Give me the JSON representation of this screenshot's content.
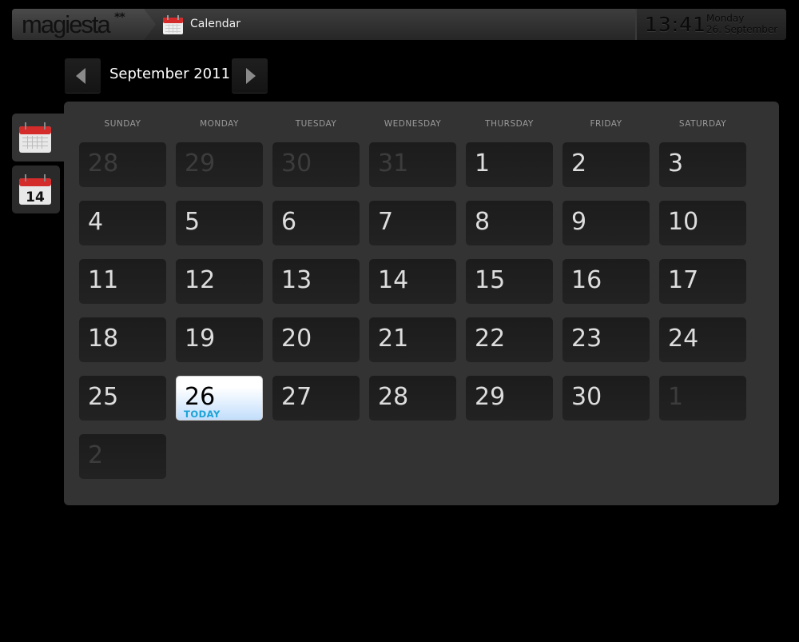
{
  "header": {
    "logo": "magiesta",
    "logo_mark": "**",
    "app_icon": "calendar-icon",
    "app_title": "Calendar",
    "clock_time": "13:41",
    "clock_weekday": "Monday",
    "clock_date": "26. September"
  },
  "nav": {
    "prev_icon": "triangle-left-icon",
    "next_icon": "triangle-right-icon",
    "month_label": "September 2011"
  },
  "side_tabs": [
    {
      "name": "month-view",
      "icon": "calendar-month-icon",
      "active": true
    },
    {
      "name": "day-view",
      "icon": "calendar-day-icon",
      "label": "14",
      "active": false
    }
  ],
  "calendar": {
    "weekdays": [
      "SUNDAY",
      "MONDAY",
      "TUESDAY",
      "WEDNESDAY",
      "THURSDAY",
      "FRIDAY",
      "SATURDAY"
    ],
    "today_label": "TODAY",
    "colors": {
      "today_text": "#1aa3d6",
      "today_bg_bottom": "#c2defc"
    },
    "weeks": [
      [
        {
          "d": "28",
          "other": true
        },
        {
          "d": "29",
          "other": true
        },
        {
          "d": "30",
          "other": true
        },
        {
          "d": "31",
          "other": true
        },
        {
          "d": "1"
        },
        {
          "d": "2"
        },
        {
          "d": "3"
        }
      ],
      [
        {
          "d": "4"
        },
        {
          "d": "5"
        },
        {
          "d": "6"
        },
        {
          "d": "7"
        },
        {
          "d": "8"
        },
        {
          "d": "9"
        },
        {
          "d": "10"
        }
      ],
      [
        {
          "d": "11"
        },
        {
          "d": "12"
        },
        {
          "d": "13"
        },
        {
          "d": "14"
        },
        {
          "d": "15"
        },
        {
          "d": "16"
        },
        {
          "d": "17"
        }
      ],
      [
        {
          "d": "18"
        },
        {
          "d": "19"
        },
        {
          "d": "20"
        },
        {
          "d": "21"
        },
        {
          "d": "22"
        },
        {
          "d": "23"
        },
        {
          "d": "24"
        }
      ],
      [
        {
          "d": "25"
        },
        {
          "d": "26",
          "today": true
        },
        {
          "d": "27"
        },
        {
          "d": "28"
        },
        {
          "d": "29"
        },
        {
          "d": "30"
        },
        {
          "d": "1",
          "other": true
        }
      ],
      [
        {
          "d": "2",
          "other": true
        }
      ]
    ]
  }
}
